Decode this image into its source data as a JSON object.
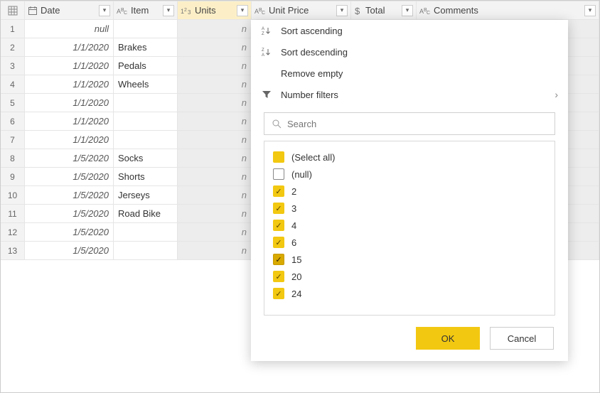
{
  "columns": {
    "date": {
      "label": "Date",
      "type": "date"
    },
    "item": {
      "label": "Item",
      "type": "text"
    },
    "units": {
      "label": "Units",
      "type": "number"
    },
    "price": {
      "label": "Unit Price",
      "type": "text"
    },
    "total": {
      "label": "Total",
      "type": "currency"
    },
    "comm": {
      "label": "Comments",
      "type": "text"
    }
  },
  "rows": [
    {
      "n": "1",
      "date": "null",
      "item": ""
    },
    {
      "n": "2",
      "date": "1/1/2020",
      "item": "Brakes"
    },
    {
      "n": "3",
      "date": "1/1/2020",
      "item": "Pedals"
    },
    {
      "n": "4",
      "date": "1/1/2020",
      "item": "Wheels"
    },
    {
      "n": "5",
      "date": "1/1/2020",
      "item": ""
    },
    {
      "n": "6",
      "date": "1/1/2020",
      "item": ""
    },
    {
      "n": "7",
      "date": "1/1/2020",
      "item": ""
    },
    {
      "n": "8",
      "date": "1/5/2020",
      "item": "Socks"
    },
    {
      "n": "9",
      "date": "1/5/2020",
      "item": "Shorts"
    },
    {
      "n": "10",
      "date": "1/5/2020",
      "item": "Jerseys"
    },
    {
      "n": "11",
      "date": "1/5/2020",
      "item": "Road Bike"
    },
    {
      "n": "12",
      "date": "1/5/2020",
      "item": ""
    },
    {
      "n": "13",
      "date": "1/5/2020",
      "item": ""
    }
  ],
  "units_trunc": "n",
  "filter": {
    "sort_asc": "Sort ascending",
    "sort_desc": "Sort descending",
    "remove_empty": "Remove empty",
    "number_filters": "Number filters",
    "search_placeholder": "Search",
    "values": [
      {
        "label": "(Select all)",
        "state": "full"
      },
      {
        "label": "(null)",
        "state": "unchecked"
      },
      {
        "label": "2",
        "state": "checked"
      },
      {
        "label": "3",
        "state": "checked"
      },
      {
        "label": "4",
        "state": "checked"
      },
      {
        "label": "6",
        "state": "checked"
      },
      {
        "label": "15",
        "state": "dark"
      },
      {
        "label": "20",
        "state": "checked"
      },
      {
        "label": "24",
        "state": "checked"
      }
    ],
    "ok": "OK",
    "cancel": "Cancel"
  }
}
